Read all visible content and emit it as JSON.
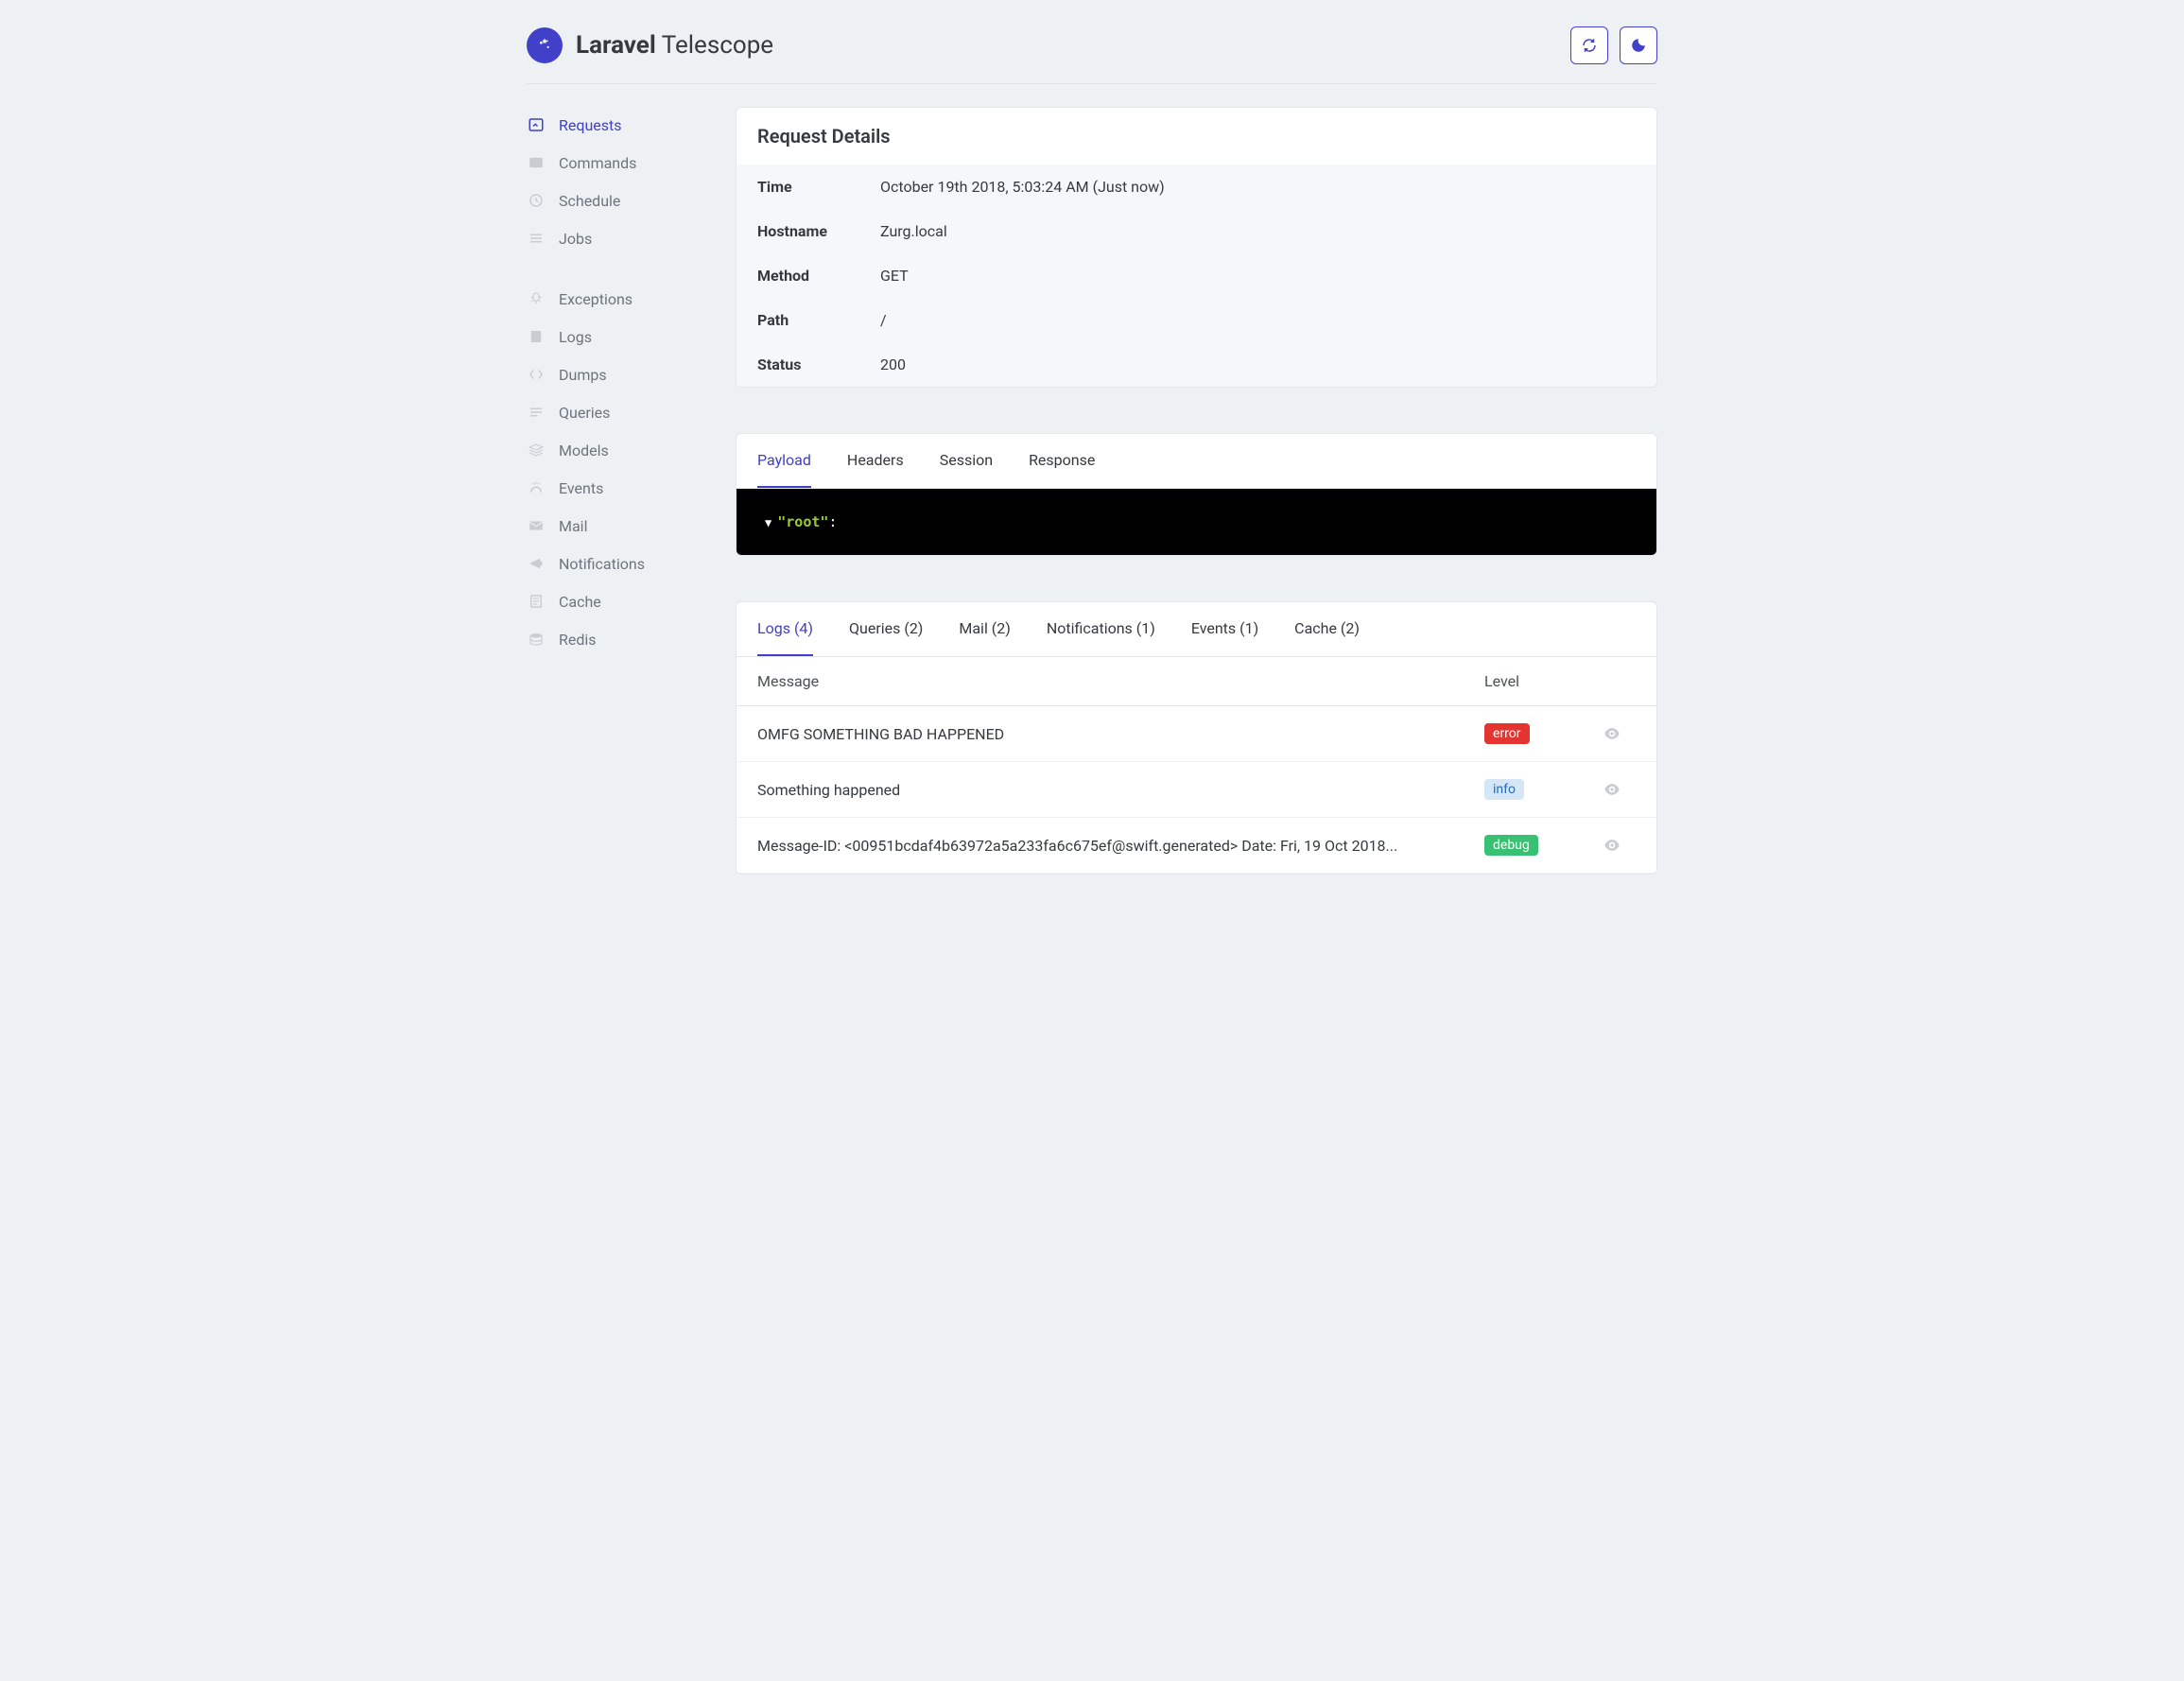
{
  "brand": {
    "bold": "Laravel",
    "light": "Telescope"
  },
  "sidebar": {
    "group1": [
      {
        "label": "Requests",
        "icon": "requests",
        "active": true
      },
      {
        "label": "Commands",
        "icon": "commands"
      },
      {
        "label": "Schedule",
        "icon": "schedule"
      },
      {
        "label": "Jobs",
        "icon": "jobs"
      }
    ],
    "group2": [
      {
        "label": "Exceptions",
        "icon": "exceptions"
      },
      {
        "label": "Logs",
        "icon": "logs"
      },
      {
        "label": "Dumps",
        "icon": "dumps"
      },
      {
        "label": "Queries",
        "icon": "queries"
      },
      {
        "label": "Models",
        "icon": "models"
      },
      {
        "label": "Events",
        "icon": "events"
      },
      {
        "label": "Mail",
        "icon": "mail"
      },
      {
        "label": "Notifications",
        "icon": "notifications"
      },
      {
        "label": "Cache",
        "icon": "cache"
      },
      {
        "label": "Redis",
        "icon": "redis"
      }
    ]
  },
  "details": {
    "title": "Request Details",
    "rows": [
      {
        "label": "Time",
        "value": "October 19th 2018, 5:03:24 AM (Just now)"
      },
      {
        "label": "Hostname",
        "value": "Zurg.local"
      },
      {
        "label": "Method",
        "value": "GET"
      },
      {
        "label": "Path",
        "value": "/"
      },
      {
        "label": "Status",
        "value": "200"
      }
    ]
  },
  "payload_tabs": [
    {
      "label": "Payload",
      "active": true
    },
    {
      "label": "Headers"
    },
    {
      "label": "Session"
    },
    {
      "label": "Response"
    }
  ],
  "payload": {
    "root_key": "\"root\""
  },
  "related_tabs": [
    {
      "label": "Logs (4)",
      "active": true
    },
    {
      "label": "Queries (2)"
    },
    {
      "label": "Mail (2)"
    },
    {
      "label": "Notifications (1)"
    },
    {
      "label": "Events (1)"
    },
    {
      "label": "Cache (2)"
    }
  ],
  "log_headers": {
    "message": "Message",
    "level": "Level"
  },
  "logs": [
    {
      "message": "OMFG SOMETHING BAD HAPPENED",
      "level": "error",
      "badge": "error"
    },
    {
      "message": "Something happened",
      "level": "info",
      "badge": "info"
    },
    {
      "message": "Message-ID: <00951bcdaf4b63972a5a233fa6c675ef@swift.generated> Date: Fri, 19 Oct 2018...",
      "level": "debug",
      "badge": "debug"
    }
  ]
}
